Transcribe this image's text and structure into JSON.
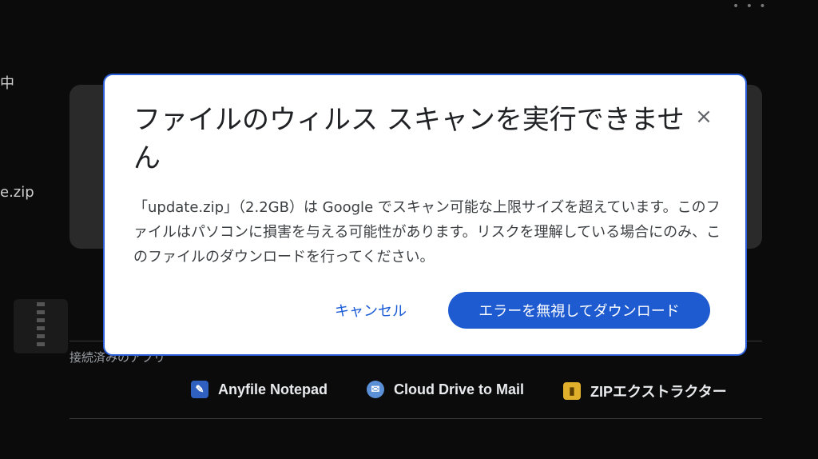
{
  "background": {
    "top_menu_icon": "more-horizontal-icon",
    "partial_text_1": "中",
    "partial_text_2": "e.zip",
    "apps_label": "接続済みのアプリ",
    "apps": [
      {
        "label": "Anyfile Notepad",
        "icon": "notepad-app-icon"
      },
      {
        "label": "Cloud Drive to Mail",
        "icon": "mail-app-icon"
      },
      {
        "label": "ZIPエクストラクター",
        "icon": "zip-extractor-app-icon"
      }
    ]
  },
  "dialog": {
    "title": "ファイルのウィルス スキャンを実行できません",
    "close_icon": "close-icon",
    "body": "「update.zip」（2.2GB）は Google でスキャン可能な上限サイズを超えています。このファイルはパソコンに損害を与える可能性があります。リスクを理解している場合にのみ、このファイルのダウンロードを行ってください。",
    "cancel_label": "キャンセル",
    "confirm_label": "エラーを無視してダウンロード"
  },
  "colors": {
    "primary": "#1f5bd0",
    "link": "#1a5bd6",
    "backdrop": "#0b0b0b"
  }
}
